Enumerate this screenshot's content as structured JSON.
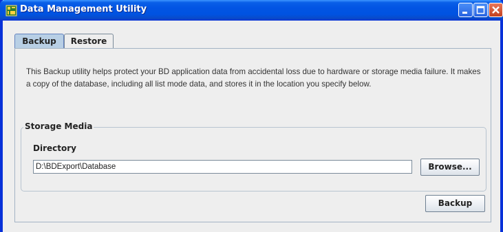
{
  "window": {
    "title": "Data Management Utility"
  },
  "tabs": [
    {
      "label": "Backup",
      "selected": true
    },
    {
      "label": "Restore",
      "selected": false
    }
  ],
  "backup_panel": {
    "description": "This Backup utility helps protect your BD application data from accidental loss due to hardware or storage media failure. It makes a copy of the database, including all list mode data, and stores it in the location you specify below.",
    "storage_media": {
      "group_title": "Storage Media",
      "directory_label": "Directory",
      "directory_value": "D:\\BDExport\\Database",
      "browse_label": "Browse..."
    },
    "backup_button_label": "Backup"
  },
  "colors": {
    "titlebar": "#0254e3",
    "selected_tab": "#b8cfe5",
    "close_button": "#c2411f"
  }
}
